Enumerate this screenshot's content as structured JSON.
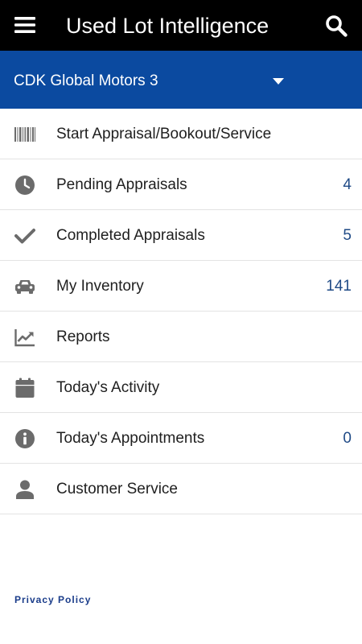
{
  "header": {
    "title": "Used Lot Intelligence",
    "menu_icon": "hamburger-menu-icon",
    "search_icon": "search-icon",
    "background": "#000000"
  },
  "dealer": {
    "selected": "CDK Global Motors 3",
    "dropdown_icon": "caret-down-icon",
    "background": "#0b4aa0"
  },
  "menu": {
    "items": [
      {
        "label": "Start Appraisal/Bookout/Service",
        "icon": "barcode-icon",
        "count": ""
      },
      {
        "label": "Pending Appraisals",
        "icon": "clock-icon",
        "count": "4"
      },
      {
        "label": "Completed Appraisals",
        "icon": "checkmark-icon",
        "count": "5"
      },
      {
        "label": "My Inventory",
        "icon": "car-icon",
        "count": "141"
      },
      {
        "label": "Reports",
        "icon": "trend-chart-icon",
        "count": ""
      },
      {
        "label": "Today's Activity",
        "icon": "calendar-icon",
        "count": ""
      },
      {
        "label": "Today's Appointments",
        "icon": "info-icon",
        "count": "0"
      },
      {
        "label": "Customer Service",
        "icon": "person-icon",
        "count": ""
      }
    ],
    "count_color": "#1f4a86",
    "icon_color": "#6b6b6b"
  },
  "footer": {
    "privacy_label": "Privacy Policy",
    "link_color": "#1a3c8a"
  }
}
